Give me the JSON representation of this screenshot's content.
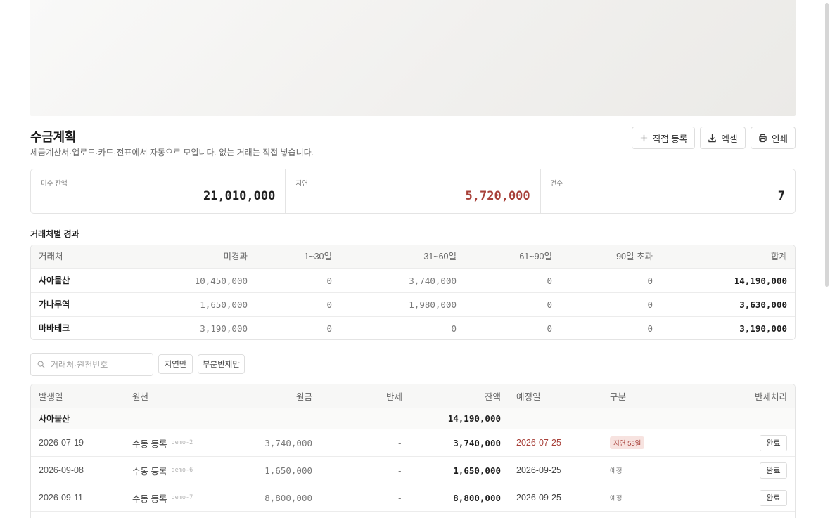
{
  "header": {
    "title": "수금계획",
    "subtitle": "세금계산서·업로드·카드·전표에서 자동으로 모입니다. 없는 거래는 직접 넣습니다.",
    "buttons": {
      "add": "직접 등록",
      "excel": "엑셀",
      "print": "인쇄"
    }
  },
  "stats": [
    {
      "label": "미수 잔액",
      "value": "21,010,000",
      "color": "#1f1f1f"
    },
    {
      "label": "지연",
      "value": "5,720,000",
      "color": "#a8413a"
    },
    {
      "label": "건수",
      "value": "7",
      "color": "#1f1f1f"
    }
  ],
  "aging": {
    "title": "거래처별 경과",
    "columns": [
      "거래처",
      "미경과",
      "1~30일",
      "31~60일",
      "61~90일",
      "90일 초과",
      "합계"
    ],
    "rows": [
      [
        "사아물산",
        "10,450,000",
        "0",
        "3,740,000",
        "0",
        "0",
        "14,190,000"
      ],
      [
        "가나무역",
        "1,650,000",
        "0",
        "1,980,000",
        "0",
        "0",
        "3,630,000"
      ],
      [
        "마바테크",
        "3,190,000",
        "0",
        "0",
        "0",
        "0",
        "3,190,000"
      ]
    ]
  },
  "filters": {
    "search_placeholder": "거래처·원천번호",
    "late_only": "지연만",
    "partial_only": "부분반제만"
  },
  "detail": {
    "columns": [
      "발생일",
      "원천",
      "원금",
      "반제",
      "잔액",
      "예정일",
      "구분",
      "반제처리"
    ],
    "group": {
      "name": "사아물산",
      "balance": "14,190,000"
    },
    "rows": [
      {
        "date": "2026-07-19",
        "source": "수동 등록",
        "source_id": "demo-2",
        "principal": "3,740,000",
        "paid": "-",
        "balance": "3,740,000",
        "due": "2026-07-25",
        "status": "지연 53일",
        "action": "완료"
      },
      {
        "date": "2026-09-08",
        "source": "수동 등록",
        "source_id": "demo-6",
        "principal": "1,650,000",
        "paid": "-",
        "balance": "1,650,000",
        "due": "2026-09-25",
        "status": "예정",
        "action": "완료"
      },
      {
        "date": "2026-09-11",
        "source": "수동 등록",
        "source_id": "demo-7",
        "principal": "8,800,000",
        "paid": "-",
        "balance": "8,800,000",
        "due": "2026-09-25",
        "status": "예정",
        "action": "완료"
      }
    ]
  }
}
